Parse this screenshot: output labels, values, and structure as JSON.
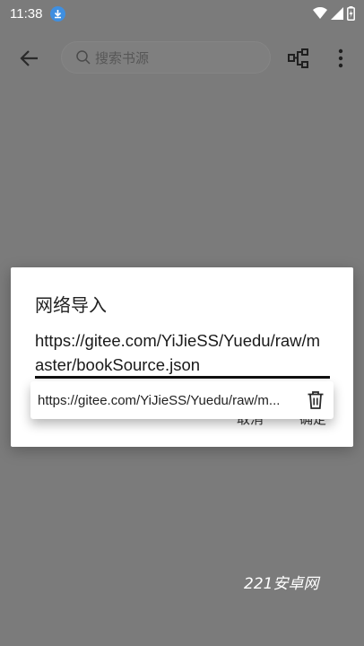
{
  "status_bar": {
    "time": "11:38"
  },
  "toolbar": {
    "search_placeholder": "搜索书源"
  },
  "dialog": {
    "title": "网络导入",
    "url_value": "https://gitee.com/YiJieSS/Yuedu/raw/master/bookSource.json",
    "cancel_label": "取消",
    "confirm_label": "确定"
  },
  "suggestion": {
    "text": "https://gitee.com/YiJieSS/Yuedu/raw/m..."
  },
  "watermark": "221安卓网",
  "colors": {
    "scrim": "#7b7b7b",
    "download_badge": "#3f8fe0"
  }
}
